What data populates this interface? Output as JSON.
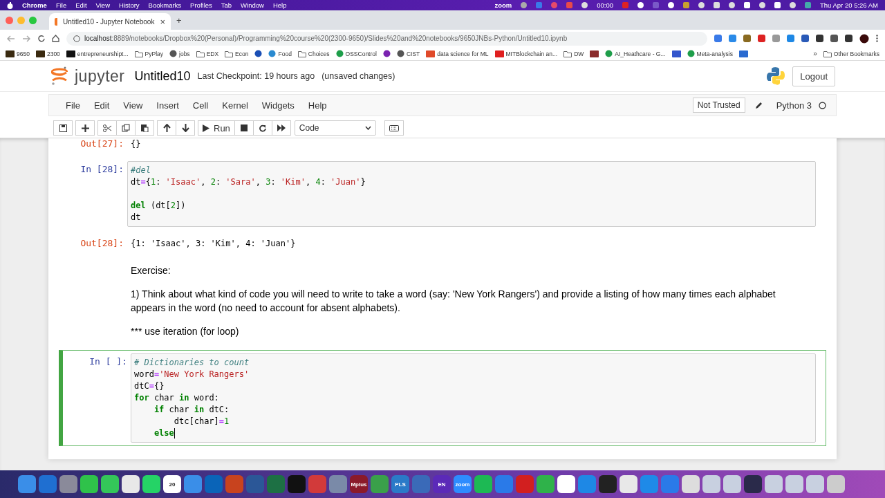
{
  "mac_menu": {
    "app": "Chrome",
    "items": [
      "File",
      "Edit",
      "View",
      "History",
      "Bookmarks",
      "Profiles",
      "Tab",
      "Window",
      "Help"
    ],
    "zoom": "zoom",
    "timer": "00:00",
    "clock": "Thu Apr 20  5:26 AM"
  },
  "browser": {
    "tab": {
      "title": "Untitled10 - Jupyter Notebook",
      "close": "×",
      "selected": true
    },
    "new_tab": "+",
    "url_host": "localhost",
    "url_rest": ":8889/notebooks/Dropbox%20(Personal)/Programming%20course%20(2300-9650)/Slides%20and%20notebooks/9650JNBs-Python/Untitled10.ipynb",
    "bookmarks": [
      {
        "label": "9650",
        "kind": "badge",
        "color": "#3a2a10"
      },
      {
        "label": "2300",
        "kind": "badge",
        "color": "#3a2a10"
      },
      {
        "label": "entrepreneurshipt...",
        "kind": "badge",
        "color": "#111111"
      },
      {
        "label": "PyPlay",
        "kind": "folder",
        "color": "#666666"
      },
      {
        "label": "jobs",
        "kind": "globe",
        "color": "#555555"
      },
      {
        "label": "EDX",
        "kind": "folder",
        "color": "#666666"
      },
      {
        "label": "Econ",
        "kind": "folder",
        "color": "#666666"
      },
      {
        "kind": "globe",
        "color": "#1a4fb5"
      },
      {
        "label": "Food",
        "kind": "globe",
        "color": "#2a8ad0"
      },
      {
        "label": "Choices",
        "kind": "folder",
        "color": "#666666"
      },
      {
        "label": "OSSControl",
        "kind": "globe",
        "color": "#1e9e4a"
      },
      {
        "kind": "globe",
        "color": "#7a22b0"
      },
      {
        "label": "CIST",
        "kind": "globe",
        "color": "#555555"
      },
      {
        "label": "data science for ML",
        "kind": "badge",
        "color": "#e04a2a"
      },
      {
        "label": "MITBlockchain an...",
        "kind": "badge",
        "color": "#e02020"
      },
      {
        "label": "DW",
        "kind": "folder",
        "color": "#666666"
      },
      {
        "kind": "badge",
        "color": "#8a2a2a"
      },
      {
        "label": "AI_Heathcare - G...",
        "kind": "globe",
        "color": "#1e9e4a"
      },
      {
        "kind": "badge",
        "color": "#3355cc"
      },
      {
        "label": "Meta-analysis",
        "kind": "globe",
        "color": "#1e9e4a"
      },
      {
        "kind": "badge",
        "color": "#2a6ad0"
      }
    ],
    "more": "»",
    "other": "Other Bookmarks"
  },
  "jupyter": {
    "logo": "jupyter",
    "title": "Untitled10",
    "checkpoint": "Last Checkpoint: 19 hours ago",
    "unsaved": "(unsaved changes)",
    "logout": "Logout",
    "menu": [
      "File",
      "Edit",
      "View",
      "Insert",
      "Cell",
      "Kernel",
      "Widgets",
      "Help"
    ],
    "trusted": "Not Trusted",
    "kernel": "Python 3",
    "run": "Run",
    "cell_type": "Code"
  },
  "cells": [
    {
      "kind": "output",
      "prompt": "Out[27]:",
      "text": "{}"
    },
    {
      "kind": "code",
      "prompt": "In [28]:",
      "selected": false,
      "editing": false,
      "lines": [
        {
          "gap_before": false,
          "tokens": [
            {
              "t": "#del",
              "kind": "comment"
            }
          ]
        },
        {
          "gap_before": false,
          "tokens": [
            {
              "t": "dt",
              "kind": "plain"
            },
            {
              "t": "=",
              "kind": "op"
            },
            {
              "t": "{",
              "kind": "plain"
            },
            {
              "t": "1",
              "kind": "num"
            },
            {
              "t": ": ",
              "kind": "plain"
            },
            {
              "t": "'Isaac'",
              "kind": "str"
            },
            {
              "t": ", ",
              "kind": "plain"
            },
            {
              "t": "2",
              "kind": "num"
            },
            {
              "t": ": ",
              "kind": "plain"
            },
            {
              "t": "'Sara'",
              "kind": "str"
            },
            {
              "t": ", ",
              "kind": "plain"
            },
            {
              "t": "3",
              "kind": "num"
            },
            {
              "t": ": ",
              "kind": "plain"
            },
            {
              "t": "'Kim'",
              "kind": "str"
            },
            {
              "t": ", ",
              "kind": "plain"
            },
            {
              "t": "4",
              "kind": "num"
            },
            {
              "t": ": ",
              "kind": "plain"
            },
            {
              "t": "'Juan'",
              "kind": "str"
            },
            {
              "t": "}",
              "kind": "plain"
            }
          ]
        },
        {
          "gap_before": true,
          "tokens": [
            {
              "t": "del",
              "kind": "kw"
            },
            {
              "t": " (dt[",
              "kind": "plain"
            },
            {
              "t": "2",
              "kind": "num"
            },
            {
              "t": "])",
              "kind": "plain"
            }
          ]
        },
        {
          "gap_before": false,
          "tokens": [
            {
              "t": "dt",
              "kind": "plain"
            }
          ]
        }
      ]
    },
    {
      "kind": "output",
      "prompt": "Out[28]:",
      "text": "{1: 'Isaac', 3: 'Kim', 4: 'Juan'}"
    },
    {
      "kind": "markdown",
      "paragraphs": [
        "Exercise:",
        "1) Think about what kind of code you will need to write to take a word (say: 'New York Rangers') and provide a listing of how many times each alphabet appears in the word (no need to account for absent alphabets).",
        "*** use iteration (for loop)"
      ]
    },
    {
      "kind": "code",
      "prompt": "In [ ]:",
      "selected": true,
      "editing": true,
      "lines": [
        {
          "gap_before": false,
          "tokens": [
            {
              "t": "# Dictionaries to count",
              "kind": "comment"
            }
          ]
        },
        {
          "gap_before": false,
          "tokens": [
            {
              "t": "word",
              "kind": "plain"
            },
            {
              "t": "=",
              "kind": "op"
            },
            {
              "t": "'New York Rangers'",
              "kind": "str"
            }
          ]
        },
        {
          "gap_before": false,
          "tokens": [
            {
              "t": "dtC",
              "kind": "plain"
            },
            {
              "t": "=",
              "kind": "op"
            },
            {
              "t": "{}",
              "kind": "plain"
            }
          ]
        },
        {
          "gap_before": false,
          "tokens": [
            {
              "t": "for",
              "kind": "kw"
            },
            {
              "t": " char ",
              "kind": "plain"
            },
            {
              "t": "in",
              "kind": "kw"
            },
            {
              "t": " word:",
              "kind": "plain"
            }
          ]
        },
        {
          "gap_before": false,
          "tokens": [
            {
              "t": "    if",
              "kind": "kw"
            },
            {
              "t": " char ",
              "kind": "plain"
            },
            {
              "t": "in",
              "kind": "kw"
            },
            {
              "t": " dtC:",
              "kind": "plain"
            }
          ]
        },
        {
          "gap_before": false,
          "tokens": [
            {
              "t": "        dtc[char]",
              "kind": "plain"
            },
            {
              "t": "=",
              "kind": "op"
            },
            {
              "t": "1",
              "kind": "num"
            }
          ]
        },
        {
          "gap_before": false,
          "tokens": [
            {
              "t": "    else",
              "kind": "kw"
            }
          ]
        }
      ]
    }
  ],
  "dock": [
    {
      "color": "#3a8ee8"
    },
    {
      "color": "#1f6fd1"
    },
    {
      "color": "#8a8a9a"
    },
    {
      "color": "#2fc24a"
    },
    {
      "color": "#34c759"
    },
    {
      "color": "#e8e8e8"
    },
    {
      "color": "#25d366"
    },
    {
      "color": "#ffffff",
      "label": "20"
    },
    {
      "color": "#3a8ee8"
    },
    {
      "color": "#0a64b8"
    },
    {
      "color": "#c8431e"
    },
    {
      "color": "#2b5797"
    },
    {
      "color": "#1d7044"
    },
    {
      "color": "#111111"
    },
    {
      "color": "#d23a3a"
    },
    {
      "color": "#7a8aa8"
    },
    {
      "color": "#8b1a2a",
      "label": "Mplus"
    },
    {
      "color": "#3aa04a"
    },
    {
      "color": "#2a7ac8",
      "label": "PLS"
    },
    {
      "color": "#3a6ab8"
    },
    {
      "color": "#5b2ab8",
      "label": "EN"
    },
    {
      "color": "#2d8cff",
      "label": "zoom"
    },
    {
      "color": "#1db954"
    },
    {
      "color": "#2a7ae8"
    },
    {
      "color": "#d21f1f"
    },
    {
      "color": "#2fb24a"
    },
    {
      "color": "#ffffff"
    },
    {
      "color": "#1e88e5"
    },
    {
      "color": "#222222"
    },
    {
      "color": "#e8e8e8"
    },
    {
      "color": "#1e8ae8"
    },
    {
      "color": "#2a7ae8"
    },
    {
      "color": "#dddddd"
    },
    {
      "color": "#c8d0e0"
    },
    {
      "color": "#c8d0e0"
    },
    {
      "color": "#2a2a4a"
    },
    {
      "color": "#c8d0e0"
    },
    {
      "color": "#c8d0e0"
    },
    {
      "color": "#c8d0e0"
    },
    {
      "color": "#cccccc"
    }
  ]
}
